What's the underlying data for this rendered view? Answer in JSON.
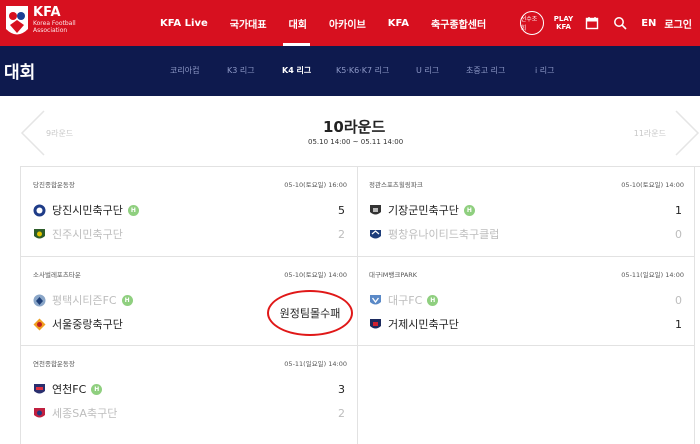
{
  "header": {
    "brand": "KFA",
    "brand_sub1": "Korea Football",
    "brand_sub2": "Association",
    "menu": [
      "KFA Live",
      "국가대표",
      "대회",
      "아카이브",
      "KFA",
      "축구종합센터"
    ],
    "search_circle_label": "선수조회",
    "play_kfa_1": "PLAY",
    "play_kfa_2": "KFA",
    "lang": "EN",
    "login": "로그인"
  },
  "subnav": {
    "title": "대회",
    "tabs": [
      "코리아컵",
      "K3 리그",
      "K4 리그",
      "K5·K6·K7 리그",
      "U 리그",
      "초중고 리그",
      "i 리그"
    ],
    "active_tab": "K4 리그"
  },
  "round": {
    "prev": "9라운드",
    "title": "10라운드",
    "dates": "05.10 14:00 ~ 05.11 14:00",
    "next": "11라운드"
  },
  "matches": [
    {
      "venue": "당진종합운동장",
      "datetime": "05-10(토요일) 16:00",
      "home": {
        "name": "당진시민축구단",
        "score": "5",
        "badge": "H"
      },
      "away": {
        "name": "진주시민축구단",
        "score": "2"
      }
    },
    {
      "venue": "정관스포츠힐링파크",
      "datetime": "05-10(토요일) 14:00",
      "home": {
        "name": "기장군민축구단",
        "score": "1",
        "badge": "H"
      },
      "away": {
        "name": "평창유나이티드축구클럽",
        "score": "0"
      }
    },
    {
      "venue": "소사벌레포츠타운",
      "datetime": "05-10(토요일) 14:00",
      "home": {
        "name": "평택시티즌FC",
        "score": "",
        "badge": "H"
      },
      "away": {
        "name": "서울중랑축구단",
        "score": ""
      },
      "note": "원정팀몰수패"
    },
    {
      "venue": "대구iM뱅크PARK",
      "datetime": "05-11(일요일) 14:00",
      "home": {
        "name": "대구FC",
        "score": "0",
        "badge": "H"
      },
      "away": {
        "name": "거제시민축구단",
        "score": "1"
      }
    },
    {
      "venue": "연천종합운동장",
      "datetime": "05-11(일요일) 14:00",
      "home": {
        "name": "연천FC",
        "score": "3",
        "badge": "H"
      },
      "away": {
        "name": "세종SA축구단",
        "score": "2"
      }
    }
  ]
}
